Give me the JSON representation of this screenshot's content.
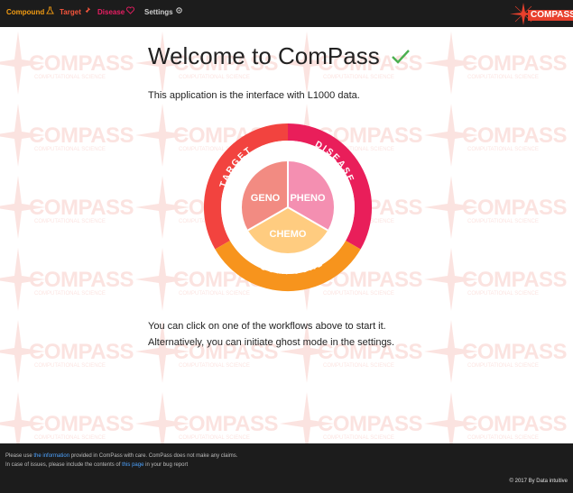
{
  "nav": {
    "compound": "Compound",
    "target": "Target",
    "disease": "Disease",
    "settings": "Settings",
    "brand": "COMPASS"
  },
  "watermark": {
    "word": "COMPASS",
    "sub": "COMPUTATIONAL SCIENCE"
  },
  "main": {
    "title": "Welcome to ComPass",
    "intro": "This application is the interface with L1000 data.",
    "hint_line1": "You can click on one of the workflows above to start it.",
    "hint_line2": "Alternatively, you can initiate ghost mode in the settings."
  },
  "wheel": {
    "outer": {
      "target": "TARGET",
      "disease": "DISEASE",
      "compound": "COMPOUND"
    },
    "inner": {
      "geno": "GENO",
      "pheno": "PHENO",
      "chemo": "CHEMO"
    }
  },
  "footer": {
    "prefix1": "Please use ",
    "link1": "the information",
    "suffix1": " provided in ComPass with care. ComPass does not make any claims.",
    "prefix2": "In case of issues, please include the contents of ",
    "link2": "this page",
    "suffix2": " in your bug report",
    "copyright": "© 2017 By Data intuitive"
  },
  "colors": {
    "compound": "#f39c12",
    "target": "#f5553c",
    "disease": "#e91e63",
    "geno": "#f28b82",
    "pheno": "#f48fb1",
    "chemo": "#ffcc80",
    "check": "#4caf50"
  }
}
